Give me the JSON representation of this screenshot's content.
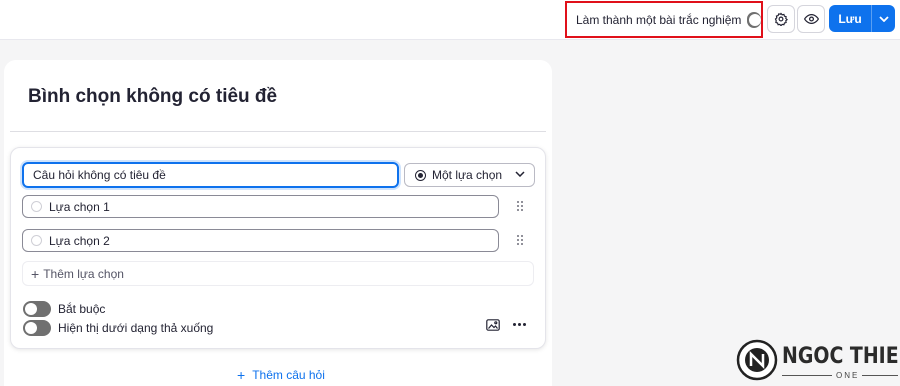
{
  "topbar": {
    "quiz_toggle_label": "Làm thành một bài trắc nghiệm",
    "quiz_toggle_on": false,
    "save_label": "Lưu"
  },
  "poll": {
    "title": "Bình chọn không có tiêu đề"
  },
  "question": {
    "input_value": "Câu hỏi không có tiêu đề",
    "type_selected": "Một lựa chọn",
    "options": [
      "Lựa chọn 1",
      "Lựa chọn 2"
    ],
    "add_option_label": "Thêm lựa chọn",
    "required_label": "Bắt buộc",
    "dropdown_label": "Hiện thị dưới dạng thả xuống"
  },
  "add_question_label": "Thêm câu hỏi",
  "watermark": {
    "name": "NGOC THIEN",
    "sub": "ONE"
  },
  "colors": {
    "accent": "#0e72ed",
    "highlight_box": "#e0101a",
    "toggle_off": "#707070"
  },
  "icons": [
    "gear-icon",
    "eye-icon",
    "chevron-down-icon",
    "drag-handle-icon",
    "image-icon",
    "more-icon",
    "plus-icon"
  ]
}
